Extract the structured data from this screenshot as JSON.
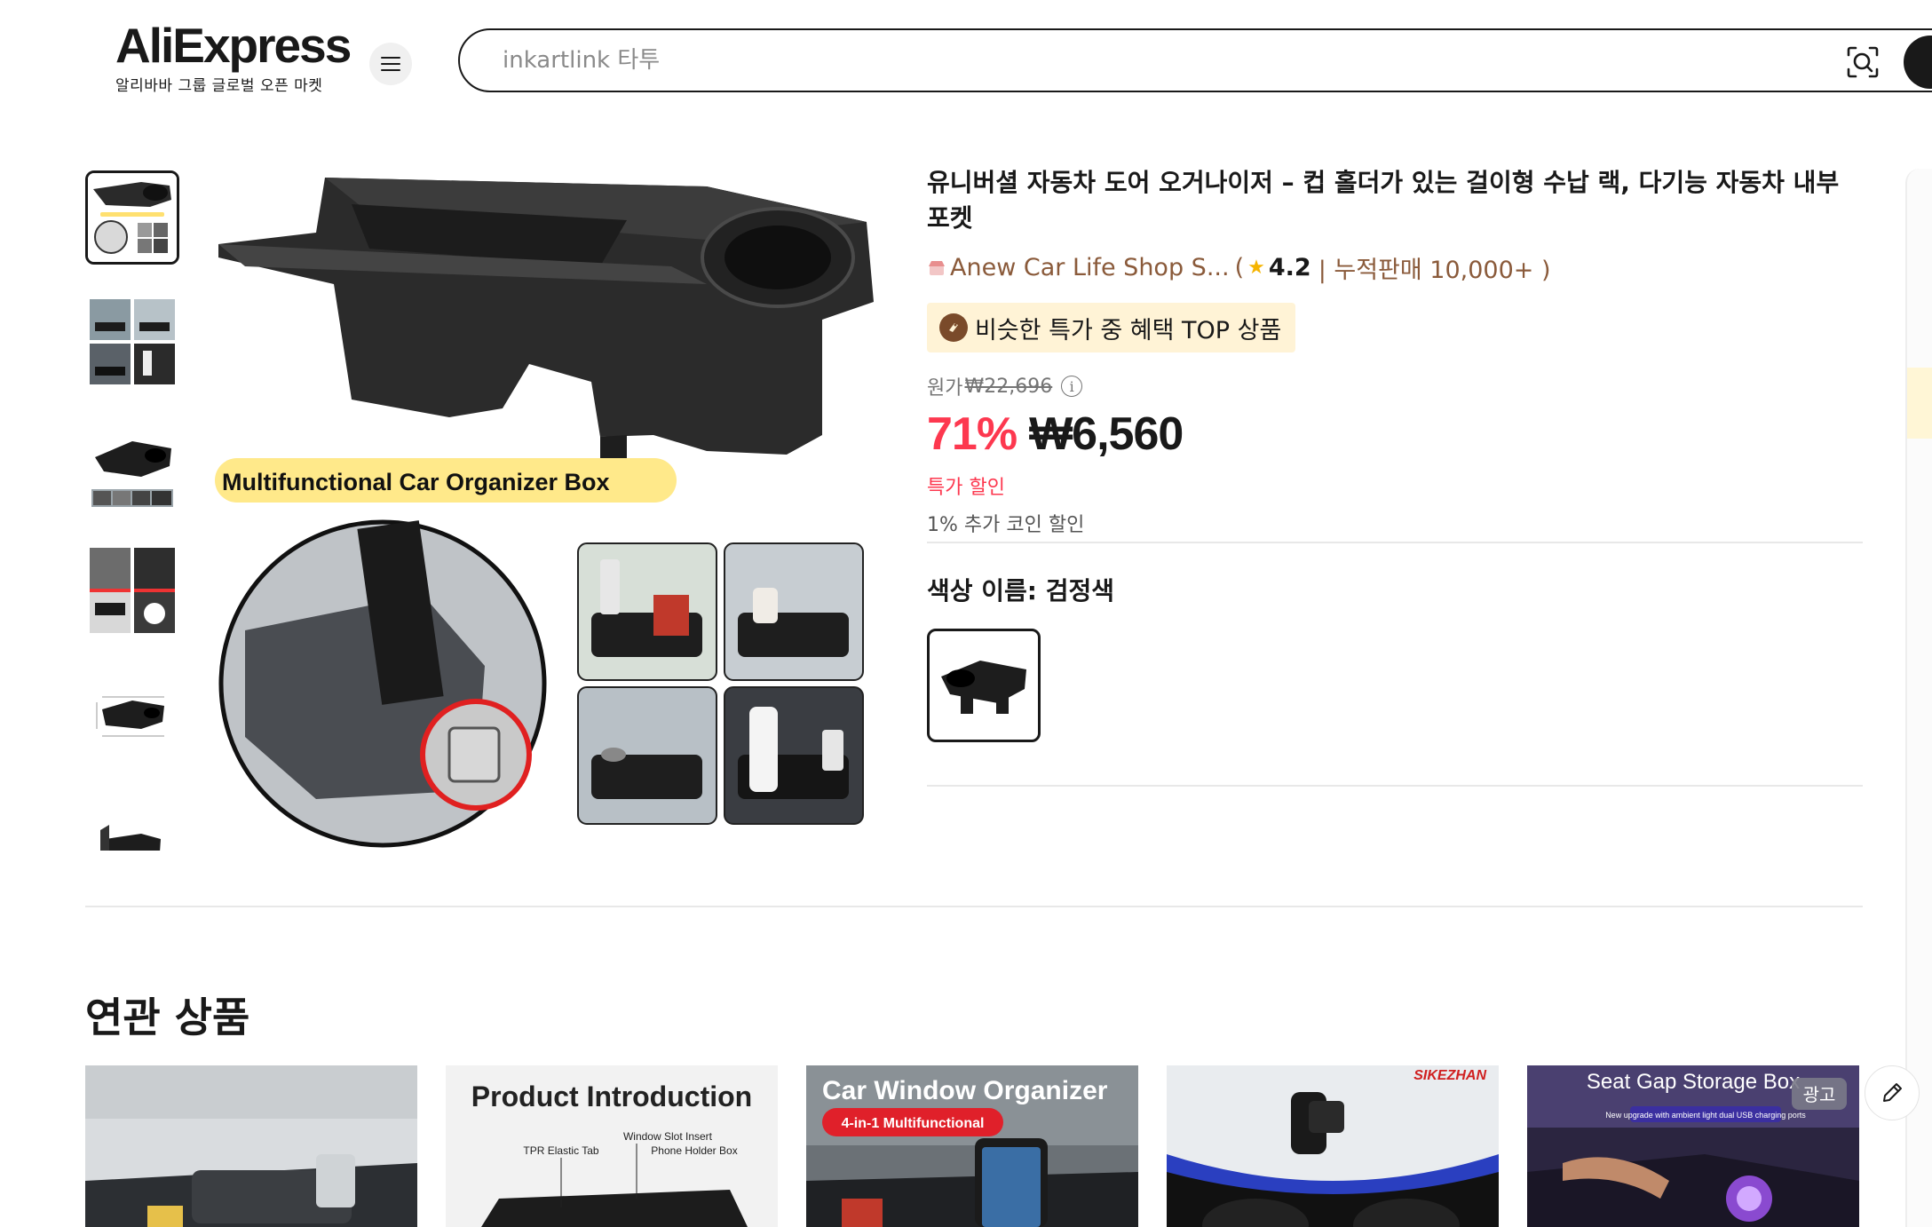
{
  "header": {
    "logo_text": "AliExpress",
    "logo_subtitle": "알리바바 그룹 글로벌 오픈 마켓",
    "search_placeholder": "inkartlink 타투"
  },
  "gallery": {
    "main_image_caption": "Multifunctional Car Organizer Box",
    "thumbnail_count_visible": 6,
    "active_thumbnail_index": 0
  },
  "product": {
    "title": "유니버셜 자동차 도어 오거나이저 – 컵 홀더가 있는 걸이형 수납 랙, 다기능 자동차 내부 포켓",
    "store_name": "Anew Car Life Shop S...",
    "store_open": "(",
    "rating": "4.2",
    "sales_text": "| 누적판매 10,000+ )",
    "badge_text": "비슷한 특가 중 혜택 TOP 상품",
    "original_price_label": "원가",
    "original_price": "₩22,696",
    "discount": "71%",
    "price": "₩6,560",
    "sale_label": "특가 할인",
    "coin_discount": "1% 추가 코인 할인",
    "color_label": "색상 이름: 검정색"
  },
  "related": {
    "title": "연관 상품",
    "cards": [
      {
        "headline": ""
      },
      {
        "headline": "Product Introduction",
        "labels": [
          "Window Slot Insert",
          "TPR Elastic Tab",
          "Phone Holder Box"
        ]
      },
      {
        "headline": "Car Window Organizer",
        "tag": "4-in-1 Multifunctional"
      },
      {
        "brand": "SIKEZHAN"
      },
      {
        "headline": "Seat Gap Storage Box",
        "sub": "New upgrade with ambient light dual USB charging ports",
        "ad_badge": "광고"
      }
    ]
  },
  "colors": {
    "accent_red": "#fd384f",
    "text": "#191919",
    "store_brown": "#8a5a3a",
    "badge_bg": "#fff3d6"
  }
}
